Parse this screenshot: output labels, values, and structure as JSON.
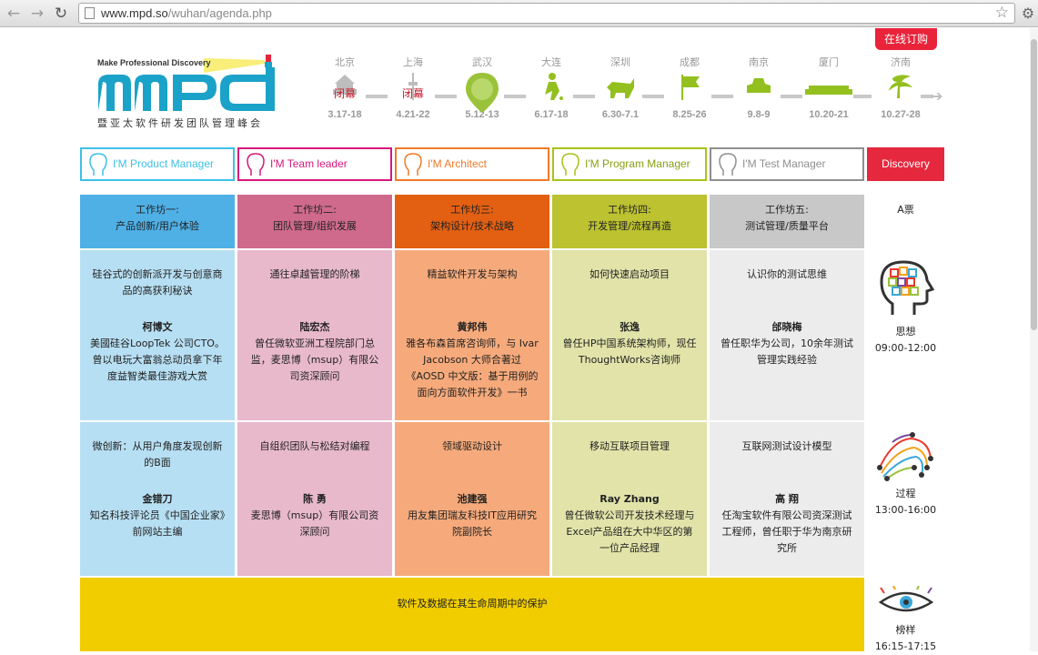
{
  "browser": {
    "url_host": "www.mpd.so",
    "url_path": "/wuhan/agenda.php"
  },
  "header": {
    "order_button": "在线订购",
    "logo_tagline": "Make Professional Discovery",
    "logo_text": "mpd",
    "logo_subtitle": "暨亚太软件研发团队管理峰会"
  },
  "timeline": [
    {
      "city": "北京",
      "date": "3.17-18",
      "closed": "闭幕"
    },
    {
      "city": "上海",
      "date": "4.21-22",
      "closed": "闭幕"
    },
    {
      "city": "武汉",
      "date": "5.12-13",
      "closed": ""
    },
    {
      "city": "大连",
      "date": "6.17-18",
      "closed": ""
    },
    {
      "city": "深圳",
      "date": "6.30-7.1",
      "closed": ""
    },
    {
      "city": "成都",
      "date": "8.25-26",
      "closed": ""
    },
    {
      "city": "南京",
      "date": "9.8-9",
      "closed": ""
    },
    {
      "city": "厦门",
      "date": "10.20-21",
      "closed": ""
    },
    {
      "city": "济南",
      "date": "10.27-28",
      "closed": ""
    }
  ],
  "roles": [
    {
      "label": "I'M Product Manager",
      "color": "#3ec0e6"
    },
    {
      "label": "I'M Team leader",
      "color": "#d6197a"
    },
    {
      "label": "I'M Architect",
      "color": "#f07a27"
    },
    {
      "label": "I'M Program Manager",
      "color": "#a9c21b"
    },
    {
      "label": "I'M Test Manager",
      "color": "#8f8f8f"
    },
    {
      "label": "Discovery",
      "color": "#e6283e"
    }
  ],
  "workshops": [
    {
      "title": "工作坊一:",
      "subtitle": "产品创新/用户体验",
      "head_color": "#4fb0e6",
      "body_color": "#b7dff3"
    },
    {
      "title": "工作坊二:",
      "subtitle": "团队管理/组织发展",
      "head_color": "#cf6a8c",
      "body_color": "#e8b9cb"
    },
    {
      "title": "工作坊三:",
      "subtitle": "架构设计/技术战略",
      "head_color": "#e35f12",
      "body_color": "#f6aa7b"
    },
    {
      "title": "工作坊四:",
      "subtitle": "开发管理/流程再造",
      "head_color": "#bcc230",
      "body_color": "#e1e3a9"
    },
    {
      "title": "工作坊五:",
      "subtitle": "测试管理/质量平台",
      "head_color": "#c8c8c8",
      "body_color": "#ececec"
    }
  ],
  "session1": [
    {
      "topic": "硅谷式的创新派开发与创意商品的高获利秘诀",
      "speaker": "柯博文",
      "bio": "美國硅谷LoopTek 公司CTO。曾以电玩大富翁总动员拿下年度益智类最佳游戏大赏"
    },
    {
      "topic": "通往卓越管理的阶梯",
      "speaker": "陆宏杰",
      "bio": "曾任微软亚洲工程院部门总监，麦思博（msup）有限公司资深顾问"
    },
    {
      "topic": "精益软件开发与架构",
      "speaker": "黄邦伟",
      "bio": "雅各布森首席咨询师，与 Ivar Jacobson 大师合著过《AOSD 中文版：基于用例的面向方面软件开发》一书"
    },
    {
      "topic": "如何快速启动项目",
      "speaker": "张逸",
      "bio": "曾任HP中国系统架构师，现任ThoughtWorks咨询师"
    },
    {
      "topic": "认识你的测试思维",
      "speaker": "邰晓梅",
      "bio": "曾任职华为公司，10余年测试管理实践经验"
    }
  ],
  "session2": [
    {
      "topic": "微创新：从用户角度发现创新的B面",
      "speaker": "金错刀",
      "bio": "知名科技评论员《中国企业家》前网站主编"
    },
    {
      "topic": "自组织团队与松结对编程",
      "speaker": "陈 勇",
      "bio": "麦思博（msup）有限公司资深顾问"
    },
    {
      "topic": "领域驱动设计",
      "speaker": "池建强",
      "bio": "用友集团瑞友科技IT应用研究院副院长"
    },
    {
      "topic": "移动互联项目管理",
      "speaker": "Ray Zhang",
      "bio": "曾任微软公司开发技术经理与Excel产品组在大中华区的第一位产品经理"
    },
    {
      "topic": "互联网测试设计模型",
      "speaker": "高 翔",
      "bio": "任淘宝软件有限公司资深测试工程师，曾任职于华为南京研究所"
    }
  ],
  "banner": {
    "text": "软件及数据在其生命周期中的保护"
  },
  "side": {
    "ticket": "A票",
    "slot1": {
      "label": "思想",
      "time": "09:00-12:00",
      "icon": "head-grid-icon"
    },
    "slot2": {
      "label": "过程",
      "time": "13:00-16:00",
      "icon": "circuit-icon"
    },
    "slot3": {
      "label": "榜样",
      "time": "16:15-17:15",
      "icon": "eye-icon"
    }
  }
}
